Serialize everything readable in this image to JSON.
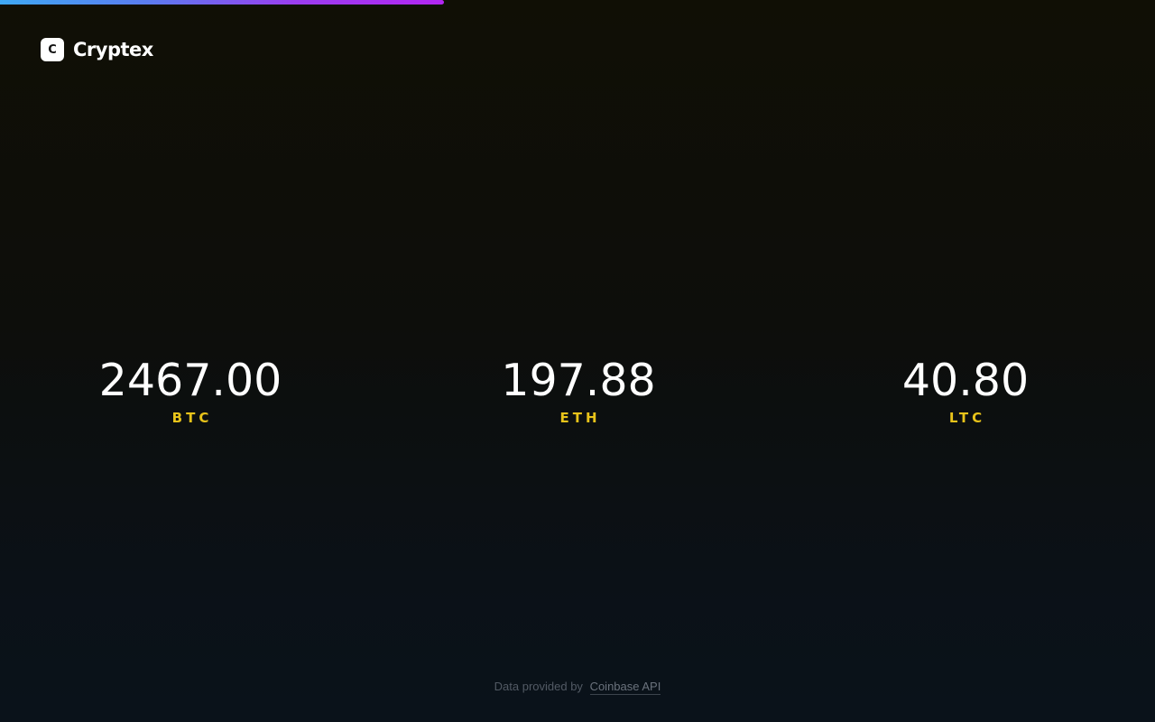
{
  "theme": {
    "accent_gradient": [
      "#3fa9f5",
      "#5b7cf0",
      "#9b3df0",
      "#b326f2"
    ],
    "symbol_color": "#e8c31a"
  },
  "loading_bar": {
    "progress_percent": 38.4
  },
  "brand": {
    "logo_letter": "C",
    "name": "Cryptex",
    "logo_icon": "square-c-logo-icon"
  },
  "tickers": [
    {
      "price": "2467.00",
      "symbol": "BTC"
    },
    {
      "price": "197.88",
      "symbol": "ETH"
    },
    {
      "price": "40.80",
      "symbol": "LTC"
    }
  ],
  "footer": {
    "prefix": "Data provided by",
    "link_text": "Coinbase API"
  }
}
